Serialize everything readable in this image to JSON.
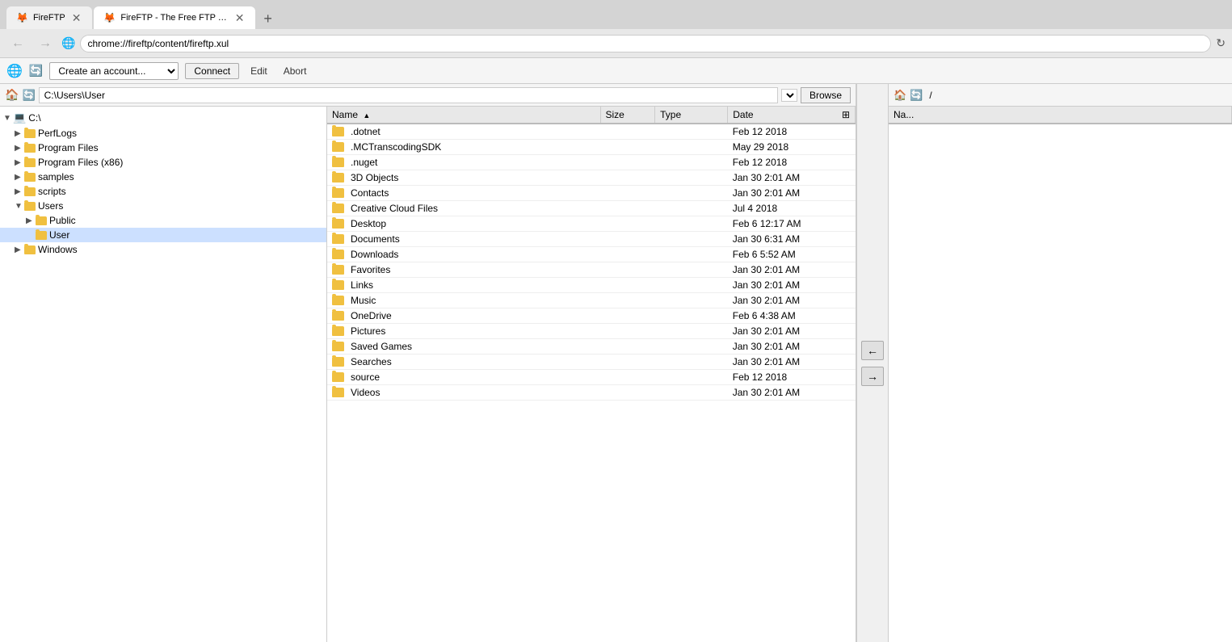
{
  "browser": {
    "tabs": [
      {
        "id": "tab1",
        "title": "FireFTP",
        "icon": "🦊",
        "active": false
      },
      {
        "id": "tab2",
        "title": "FireFTP - The Free FTP Clien...",
        "icon": "🦊",
        "active": true
      }
    ],
    "new_tab_label": "+",
    "address": "chrome://fireftp/content/fireftp.xul",
    "back_btn": "←",
    "forward_btn": "→",
    "refresh_btn": "↻"
  },
  "toolbar": {
    "account_placeholder": "Create an account...",
    "connect_label": "Connect",
    "disconnect_label": "Abort",
    "edit_label": "Edit"
  },
  "local": {
    "path": "C:\\Users\\User",
    "browse_label": "Browse",
    "icons": {
      "home": "🏠",
      "refresh": "🔄"
    }
  },
  "tree": {
    "items": [
      {
        "label": "C:\\",
        "level": 0,
        "expanded": true,
        "selected": false,
        "id": "c_root"
      },
      {
        "label": "PerfLogs",
        "level": 1,
        "expanded": false,
        "selected": false,
        "id": "perflogs"
      },
      {
        "label": "Program Files",
        "level": 1,
        "expanded": false,
        "selected": false,
        "id": "progfiles"
      },
      {
        "label": "Program Files (x86)",
        "level": 1,
        "expanded": false,
        "selected": false,
        "id": "progfilesx86"
      },
      {
        "label": "samples",
        "level": 1,
        "expanded": false,
        "selected": false,
        "id": "samples"
      },
      {
        "label": "scripts",
        "level": 1,
        "expanded": false,
        "selected": false,
        "id": "scripts"
      },
      {
        "label": "Users",
        "level": 1,
        "expanded": true,
        "selected": false,
        "id": "users"
      },
      {
        "label": "Public",
        "level": 2,
        "expanded": false,
        "selected": false,
        "id": "public"
      },
      {
        "label": "User",
        "level": 2,
        "expanded": false,
        "selected": true,
        "id": "user"
      },
      {
        "label": "Windows",
        "level": 1,
        "expanded": false,
        "selected": false,
        "id": "windows"
      }
    ]
  },
  "files": {
    "columns": {
      "name": "Name",
      "size": "Size",
      "type": "Type",
      "date": "Date"
    },
    "sort_col": "name",
    "sort_dir": "asc",
    "items": [
      {
        "name": ".dotnet",
        "size": "",
        "type": "",
        "date": "Feb 12 2018"
      },
      {
        "name": ".MCTranscodingSDK",
        "size": "",
        "type": "",
        "date": "May 29 2018"
      },
      {
        "name": ".nuget",
        "size": "",
        "type": "",
        "date": "Feb 12 2018"
      },
      {
        "name": "3D Objects",
        "size": "",
        "type": "",
        "date": "Jan 30 2:01 AM"
      },
      {
        "name": "Contacts",
        "size": "",
        "type": "",
        "date": "Jan 30 2:01 AM"
      },
      {
        "name": "Creative Cloud Files",
        "size": "",
        "type": "",
        "date": "Jul 4 2018"
      },
      {
        "name": "Desktop",
        "size": "",
        "type": "",
        "date": "Feb 6 12:17 AM"
      },
      {
        "name": "Documents",
        "size": "",
        "type": "",
        "date": "Jan 30 6:31 AM"
      },
      {
        "name": "Downloads",
        "size": "",
        "type": "",
        "date": "Feb 6 5:52 AM"
      },
      {
        "name": "Favorites",
        "size": "",
        "type": "",
        "date": "Jan 30 2:01 AM"
      },
      {
        "name": "Links",
        "size": "",
        "type": "",
        "date": "Jan 30 2:01 AM"
      },
      {
        "name": "Music",
        "size": "",
        "type": "",
        "date": "Jan 30 2:01 AM"
      },
      {
        "name": "OneDrive",
        "size": "",
        "type": "",
        "date": "Feb 6 4:38 AM"
      },
      {
        "name": "Pictures",
        "size": "",
        "type": "",
        "date": "Jan 30 2:01 AM"
      },
      {
        "name": "Saved Games",
        "size": "",
        "type": "",
        "date": "Jan 30 2:01 AM"
      },
      {
        "name": "Searches",
        "size": "",
        "type": "",
        "date": "Jan 30 2:01 AM"
      },
      {
        "name": "source",
        "size": "",
        "type": "",
        "date": "Feb 12 2018"
      },
      {
        "name": "Videos",
        "size": "",
        "type": "",
        "date": "Jan 30 2:01 AM"
      }
    ]
  },
  "transfer": {
    "left_arrow": "←",
    "right_arrow": "→"
  },
  "remote": {
    "path": "/",
    "columns": {
      "name": "Na..."
    }
  }
}
